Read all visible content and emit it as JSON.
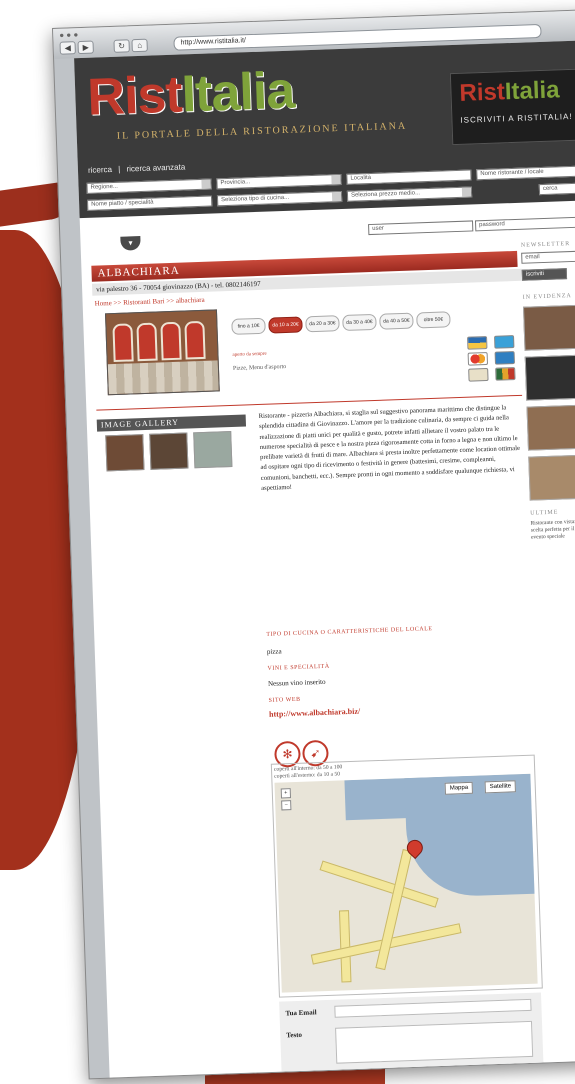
{
  "browser": {
    "url": "http://www.ristitalia.it/",
    "nav_back": "◀",
    "nav_forward": "▶",
    "nav_reload": "↻",
    "nav_home": "⌂"
  },
  "header": {
    "logo_part1": "Rist",
    "logo_part2": "Italia",
    "tagline": "IL PORTALE DELLA RISTORAZIONE ITALIANA",
    "banner_logo1": "Rist",
    "banner_logo2": "Italia",
    "banner_text": "ISCRIVITI A RISTITALIA!",
    "search_link1": "ricerca",
    "search_divider": "|",
    "search_link2": "ricerca avanzata"
  },
  "filters": {
    "region": "Regione...",
    "province": "Provincia...",
    "locality": "Località",
    "name": "Nome ristorante / locale",
    "specialty": "Nome piatto / specialità",
    "type": "Seleziona tipo di cucina...",
    "price": "Seleziona prezzo medio...",
    "login_user": "user",
    "login_pass": "password",
    "search_go": "cerca"
  },
  "restaurant": {
    "name": "ALBACHIARA",
    "address": "via palestro 36 - 70054 giovinazzo (BA) - tel. 0802146197",
    "breadcrumb": "Home >> Ristoranti Bari >> albachiara",
    "prices": [
      "fino a 10€",
      "da 10 a 20€",
      "da 20 a 30€",
      "da 30 a 40€",
      "da 40 a 50€",
      "oltre 50€"
    ],
    "selected_price_index": 1,
    "meta_label": "aperto da sempre",
    "meta_value": "Pizze, Menu d'asporto",
    "description": "Ristorante - pizzeria Albachiara, si staglia sul suggestivo panorama marittimo che distingue la splendida cittadina di Giovinazzo. L'amore per la tradizione culinaria, da sempre ci guida nella realizzazione di piatti unici per qualità e gusto, potrete infatti allietare il vostro palato tra le numerose specialità di pesce e la nostra pizza rigorosamente cotta in forno a legna e non ultimo le prelibate varietà di frutti di mare. Albachiara si presta inoltre perfettamente come location ottimale ad ospitare ogni tipo di ricevimento o festività in genere (battesimi, cresime, compleanni, comunioni, banchetti, ecc.). Sempre pronti in ogni momento a soddisfare qualunque richiesta, vi aspettiamo!",
    "specialty_label": "TIPO DI CUCINA O CARATTERISTICHE DEL LOCALE",
    "specialty_value": "pizza",
    "wine_label": "VINI E SPECIALITÀ",
    "wine_value": "Nessun vino inserito",
    "site_label": "SITO WEB",
    "site_url": "http://www.albachiara.biz/",
    "gallery_title": "IMAGE GALLERY"
  },
  "map": {
    "caption1": "coperti all'interno: da 50 a 100",
    "caption2": "coperti all'esterno: da 10 a 50",
    "btn_map": "Mappa",
    "btn_sat": "Satellite",
    "zoom_in": "+",
    "zoom_out": "−"
  },
  "form": {
    "email_label": "Tua Email",
    "text_label": "Testo"
  },
  "sidebar": {
    "newsletter": "NEWSLETTER",
    "newsletter_placeholder": "email",
    "newsletter_btn": "iscriviti",
    "photos_title": "IN EVIDENZA",
    "news_title": "ULTIME",
    "news_text": "Ristorante con vista: la scelta perfetta per il tuo evento speciale"
  }
}
